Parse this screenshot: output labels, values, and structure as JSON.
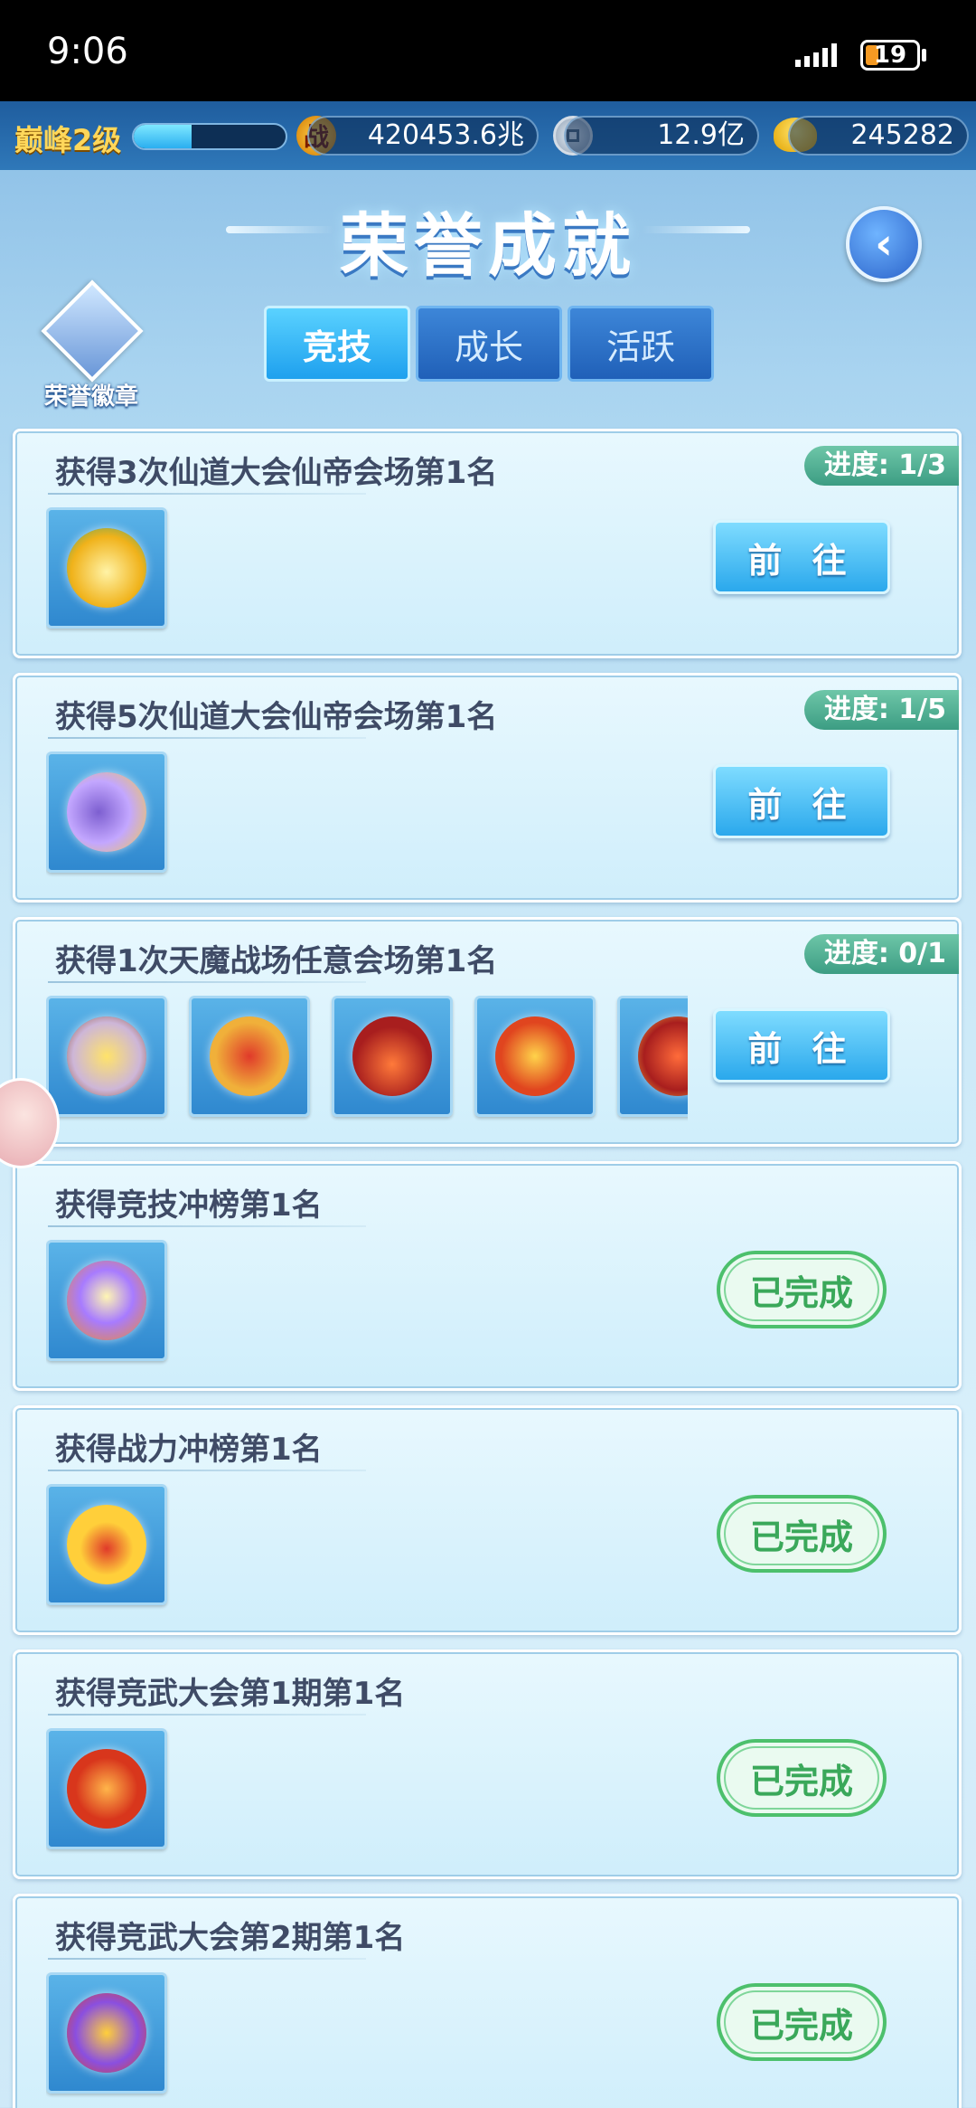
{
  "status_bar": {
    "time": "9:06",
    "battery": "19"
  },
  "resources": {
    "level_label": "巅峰2级",
    "level_progress": 0.38,
    "power_icon_label": "战",
    "power_value": "420453.6兆",
    "copper_value": "12.9亿",
    "gold_value": "245282"
  },
  "header": {
    "title": "荣誉成就",
    "badge_label": "荣誉徽章"
  },
  "tabs": [
    {
      "label": "竞技",
      "active": true
    },
    {
      "label": "成长",
      "active": false
    },
    {
      "label": "活跃",
      "active": false
    }
  ],
  "achievements": [
    {
      "title": "获得3次仙道大会仙帝会场第1名",
      "progress": "进度: 1/3",
      "action": "前 往",
      "state": "go",
      "rewards": [
        "golden-flame-icon"
      ]
    },
    {
      "title": "获得5次仙道大会仙帝会场第1名",
      "progress": "进度: 1/5",
      "action": "前 往",
      "state": "go",
      "rewards": [
        "yin-yang-flame-icon"
      ]
    },
    {
      "title": "获得1次天魔战场任意会场第1名",
      "progress": "进度: 0/1",
      "action": "前 往",
      "state": "go",
      "rewards": [
        "winged-crest-icon",
        "ruby-wing-emblem-icon",
        "red-horn-crown-icon",
        "fire-wing-icon",
        "red-orb-icon"
      ]
    },
    {
      "title": "获得竞技冲榜第1名",
      "progress": "",
      "action": "已完成",
      "state": "done",
      "rewards": [
        "star-cross-emblem-icon"
      ]
    },
    {
      "title": "获得战力冲榜第1名",
      "progress": "",
      "action": "已完成",
      "state": "done",
      "rewards": [
        "golden-crown-icon"
      ]
    },
    {
      "title": "获得竞武大会第1期第1名",
      "progress": "",
      "action": "已完成",
      "state": "done",
      "rewards": [
        "red-gem-crest-icon"
      ]
    },
    {
      "title": "获得竞武大会第2期第1名",
      "progress": "",
      "action": "已完成",
      "state": "done",
      "rewards": [
        "violet-wing-crest-icon"
      ]
    }
  ],
  "colors": {
    "go_button": "#2aa8ec",
    "done_button": "#4cc06c",
    "progress_tag": "#3c9d83",
    "title_glow": "#3a79c3"
  }
}
